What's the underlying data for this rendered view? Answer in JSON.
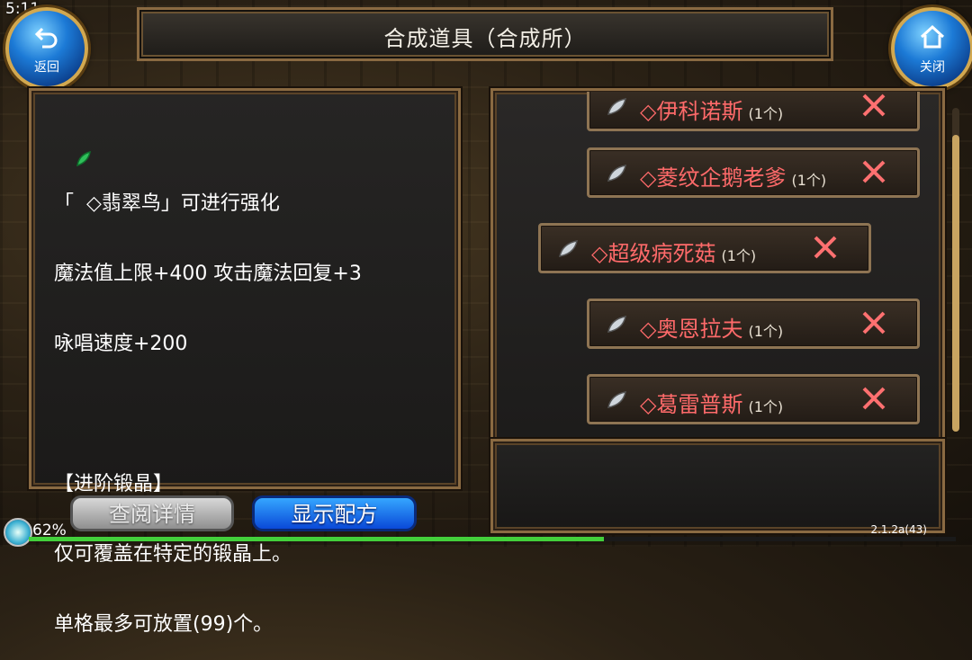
{
  "status": {
    "time": "5:11",
    "battery": "62%",
    "version": "2.1.2a(43)",
    "progress": 0.62
  },
  "title": "合成道具（合成所）",
  "nav": {
    "back_label": "返回",
    "close_label": "关闭"
  },
  "description": {
    "lines": [
      "「  ◇翡翠鸟」可进行强化",
      "魔法值上限+400 攻击魔法回复+3",
      "咏唱速度+200",
      "",
      "【进阶锻晶】",
      "仅可覆盖在特定的锻晶上。",
      "单格最多可放置(99)个。"
    ]
  },
  "materials": [
    {
      "name": "◇伊科诺斯",
      "count": "(1个)"
    },
    {
      "name": "◇菱纹企鹅老爹",
      "count": "(1个)"
    },
    {
      "name": "◇超级病死菇",
      "count": "(1个)",
      "selected": true
    },
    {
      "name": "◇奥恩拉夫",
      "count": "(1个)"
    },
    {
      "name": "◇葛雷普斯",
      "count": "(1个)"
    }
  ],
  "buttons": {
    "detail": "查阅详情",
    "recipe": "显示配方"
  },
  "colors": {
    "item_name": "#ff6a6a",
    "accent_blue": "#1c7ad6",
    "frame": "#8a6a42"
  }
}
